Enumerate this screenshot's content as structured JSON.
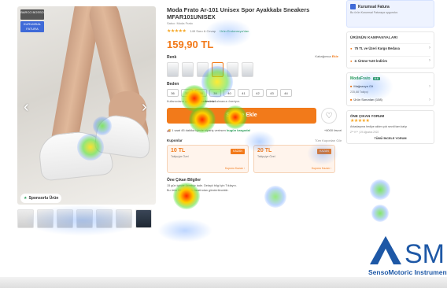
{
  "gallery": {
    "badge_top": "BARCO BOSSO",
    "badge_blue": "KURUMSAL FATURA",
    "prev_arrow": "‹",
    "next_arrow": "›",
    "sponsor_label": "Sponsorlu Ürün",
    "thumb_count": 8
  },
  "product": {
    "title": "Moda Frato Ar-101 Unisex Spor Ayakkabı Sneakers MFAR101UNISEX",
    "seller": "Satıcı: Moda Frato",
    "rating_text": "★★★★★",
    "rating_extra": "149 Soru & Cevap",
    "origin": "Ürün Endonezya'dan",
    "price": "159,90 TL",
    "right_note_prefix": "Kabağımca",
    "right_note_bold": "Ekle",
    "color_label": "Renk",
    "size_label": "Beden",
    "sizes": [
      "36",
      "37",
      "38",
      "39",
      "40",
      "41",
      "42",
      "43",
      "44"
    ],
    "size_note_prefix": "Kullanıcıların çoğu",
    "size_note_bold": "kendi bedeninizi",
    "size_note_suffix": "almanızı öneriyor.",
    "cart_label": "Sepete Ekle",
    "fav_icon": "♡",
    "delivery_prefix": "1 saat 45 dakika içinde sipariş verirsen",
    "delivery_bold": "bugün kargoda!",
    "delivery_right": "+6000 favori"
  },
  "coupons": {
    "title": "Kuponlar",
    "all_link": "Tüm Kuponları Gör",
    "items": [
      {
        "amount": "10 TL",
        "tag": "KAZAN",
        "sub": "Takipçiye Özel",
        "link": "Kuponu Kazan ›"
      },
      {
        "amount": "20 TL",
        "tag": "KAZAN",
        "sub": "Takipçiye Özel",
        "link": "Kuponu Kazan ›"
      }
    ]
  },
  "features": {
    "title": "Öne Çıkan Bilgiler",
    "items": [
      "15 gün içinde ücretsiz iade. Detaylı bilgi için Tıklayın.",
      "Bu ürün Moda Frato tarafından gönderilecektir."
    ]
  },
  "sidebar": {
    "corporate_title": "Kurumsal Fatura",
    "corporate_sub": "Bu ürün Kurumsal Faturaya uygundur.",
    "campaigns_head": "ÜRÜNÜN KAMPANYALARI",
    "campaigns": [
      "75 TL ve Üzeri Kargo Bedava",
      "2. Ürüne %20 İndirim"
    ],
    "store_name": "ModaFrato",
    "store_score": "8.6",
    "store_rows": [
      "Mağazaya Git",
      "Ürün Sorunları (108)"
    ],
    "store_followers": "235,88 Takipçi",
    "review_head": "ÖNE ÇIKAN YORUM",
    "review_stars": "★★★★★",
    "review_text": "Arkadaşıma hediye aldım çok sevdi tam kalıp",
    "review_meta": "Z** K** | 19 Ağustos 2022",
    "review_all": "TÜMÜ İNCELE YORUM"
  },
  "logo": {
    "brand": "SensoMotoric Instruments",
    "mark_letters": "SMI"
  },
  "colors": {
    "accent": "#f27a1a",
    "green": "#2e9e5b",
    "blue": "#3f6ad8",
    "logo_blue": "#1e58a6"
  }
}
